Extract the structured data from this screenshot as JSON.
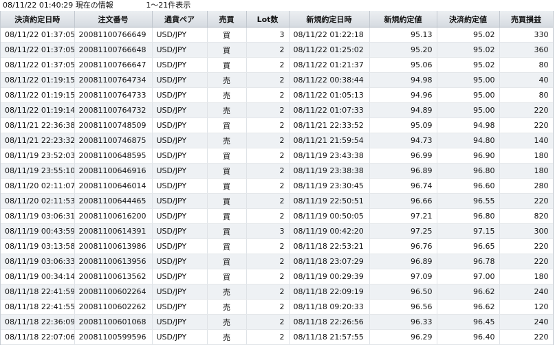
{
  "status": {
    "timestamp": "08/11/22 01:40:29",
    "label": "現在の情報",
    "range": "1～21件表示"
  },
  "table": {
    "headers": [
      "決済約定日時",
      "注文番号",
      "通貨ペア",
      "売買",
      "Lot数",
      "新規約定日時",
      "新規約定値",
      "決済約定値",
      "売買損益"
    ],
    "rows": [
      [
        "08/11/22 01:37:05",
        "20081100766649",
        "USD/JPY",
        "買",
        "3",
        "08/11/22 01:22:18",
        "95.13",
        "95.02",
        "330"
      ],
      [
        "08/11/22 01:37:05",
        "20081100766648",
        "USD/JPY",
        "買",
        "2",
        "08/11/22 01:25:02",
        "95.20",
        "95.02",
        "360"
      ],
      [
        "08/11/22 01:37:05",
        "20081100766647",
        "USD/JPY",
        "買",
        "2",
        "08/11/22 01:21:37",
        "95.06",
        "95.02",
        "80"
      ],
      [
        "08/11/22 01:19:15",
        "20081100764734",
        "USD/JPY",
        "売",
        "2",
        "08/11/22 00:38:44",
        "94.98",
        "95.00",
        "40"
      ],
      [
        "08/11/22 01:19:15",
        "20081100764733",
        "USD/JPY",
        "売",
        "2",
        "08/11/22 01:05:13",
        "94.96",
        "95.00",
        "80"
      ],
      [
        "08/11/22 01:19:14",
        "20081100764732",
        "USD/JPY",
        "売",
        "2",
        "08/11/22 01:07:33",
        "94.89",
        "95.00",
        "220"
      ],
      [
        "08/11/21 22:36:38",
        "20081100748509",
        "USD/JPY",
        "買",
        "2",
        "08/11/21 22:33:52",
        "95.09",
        "94.98",
        "220"
      ],
      [
        "08/11/21 22:23:32",
        "20081100746875",
        "USD/JPY",
        "売",
        "2",
        "08/11/21 21:59:54",
        "94.73",
        "94.80",
        "140"
      ],
      [
        "08/11/19 23:52:03",
        "20081100648595",
        "USD/JPY",
        "買",
        "2",
        "08/11/19 23:43:38",
        "96.99",
        "96.90",
        "180"
      ],
      [
        "08/11/19 23:55:10",
        "20081100646916",
        "USD/JPY",
        "買",
        "2",
        "08/11/19 23:38:38",
        "96.89",
        "96.80",
        "180"
      ],
      [
        "08/11/20 02:11:07",
        "20081100646014",
        "USD/JPY",
        "買",
        "2",
        "08/11/19 23:30:45",
        "96.74",
        "96.60",
        "280"
      ],
      [
        "08/11/20 02:11:53",
        "20081100644465",
        "USD/JPY",
        "買",
        "2",
        "08/11/19 22:50:51",
        "96.66",
        "96.55",
        "220"
      ],
      [
        "08/11/19 03:06:31",
        "20081100616200",
        "USD/JPY",
        "買",
        "2",
        "08/11/19 00:50:05",
        "97.21",
        "96.80",
        "820"
      ],
      [
        "08/11/19 00:43:59",
        "20081100614391",
        "USD/JPY",
        "買",
        "3",
        "08/11/19 00:42:20",
        "97.25",
        "97.15",
        "300"
      ],
      [
        "08/11/19 03:13:58",
        "20081100613986",
        "USD/JPY",
        "買",
        "2",
        "08/11/18 22:53:21",
        "96.76",
        "96.65",
        "220"
      ],
      [
        "08/11/19 03:06:33",
        "20081100613956",
        "USD/JPY",
        "買",
        "2",
        "08/11/18 23:07:29",
        "96.89",
        "96.78",
        "220"
      ],
      [
        "08/11/19 00:34:14",
        "20081100613562",
        "USD/JPY",
        "買",
        "2",
        "08/11/19 00:29:39",
        "97.09",
        "97.00",
        "180"
      ],
      [
        "08/11/18 22:41:59",
        "20081100602264",
        "USD/JPY",
        "売",
        "2",
        "08/11/18 22:09:19",
        "96.50",
        "96.62",
        "240"
      ],
      [
        "08/11/18 22:41:55",
        "20081100602262",
        "USD/JPY",
        "売",
        "2",
        "08/11/18 09:20:33",
        "96.56",
        "96.62",
        "120"
      ],
      [
        "08/11/18 22:36:09",
        "20081100601068",
        "USD/JPY",
        "売",
        "2",
        "08/11/18 22:26:56",
        "96.33",
        "96.45",
        "240"
      ],
      [
        "08/11/18 22:07:06",
        "20081100599596",
        "USD/JPY",
        "売",
        "2",
        "08/11/18 21:57:55",
        "96.29",
        "96.40",
        "220"
      ]
    ]
  }
}
